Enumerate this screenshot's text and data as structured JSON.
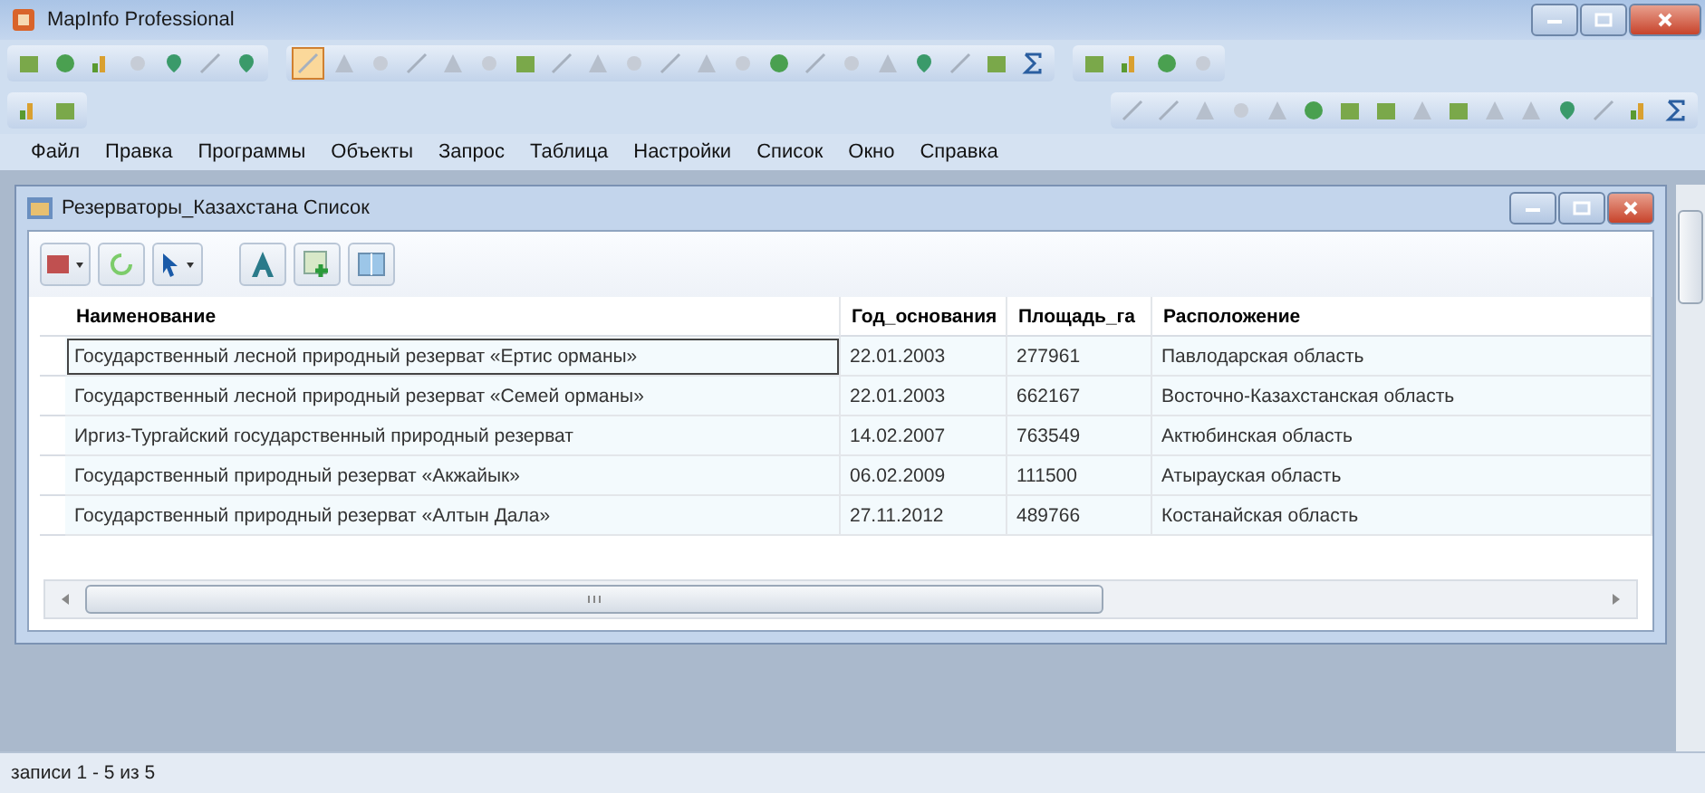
{
  "window": {
    "title": "MapInfo Professional"
  },
  "menu": [
    "Файл",
    "Правка",
    "Программы",
    "Объекты",
    "Запрос",
    "Таблица",
    "Настройки",
    "Список",
    "Окно",
    "Справка"
  ],
  "child_window": {
    "title": "Резерваторы_Казахстана Список"
  },
  "table": {
    "columns": [
      "Наименование",
      "Год_основания",
      "Площадь_га",
      "Расположение"
    ],
    "rows": [
      {
        "selected": true,
        "cells": [
          "Государственный лесной природный резерват «Ертис орманы»",
          "22.01.2003",
          "277961",
          "Павлодарская область"
        ]
      },
      {
        "selected": false,
        "cells": [
          "Государственный лесной природный резерват «Семей орманы»",
          "22.01.2003",
          "662167",
          "Восточно-Казахстанская область"
        ]
      },
      {
        "selected": false,
        "cells": [
          "Иргиз-Тургайский государственный природный резерват",
          "14.02.2007",
          "763549",
          "Актюбинская область"
        ]
      },
      {
        "selected": false,
        "cells": [
          "Государственный природный резерват «Акжайык»",
          "06.02.2009",
          "111500",
          "Атырауская область"
        ]
      },
      {
        "selected": false,
        "cells": [
          "Государственный природный резерват «Алтын Дала»",
          "27.11.2012",
          "489766",
          "Костанайская область"
        ]
      }
    ]
  },
  "status_bar": "записи 1 - 5 из 5"
}
